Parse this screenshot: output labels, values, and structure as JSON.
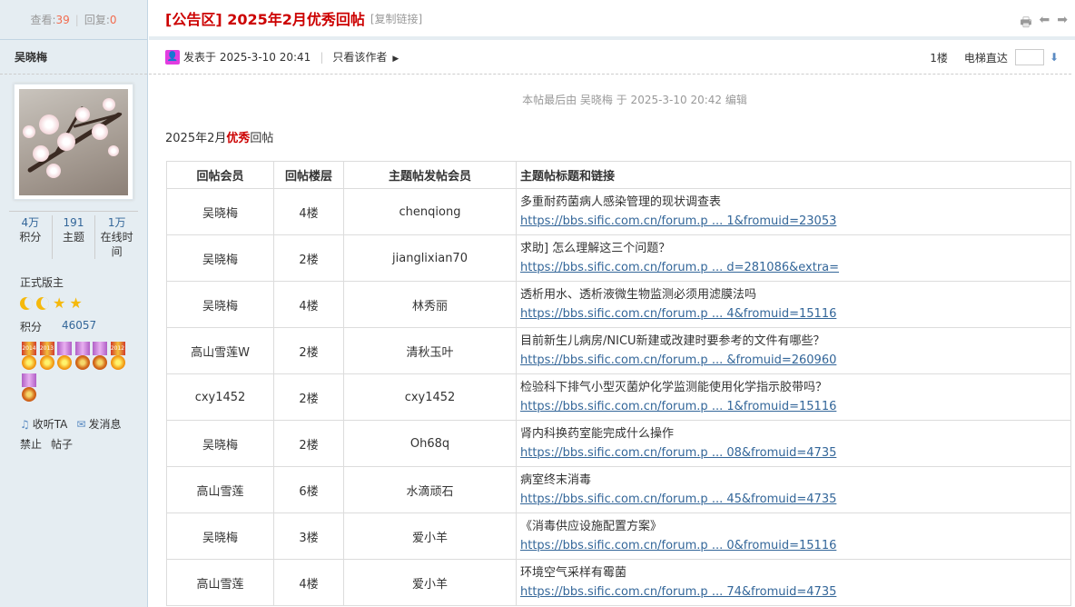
{
  "sidebar": {
    "views_label": "查看:",
    "views": "39",
    "replies_label": "回复:",
    "replies": "0",
    "author": "吴晓梅",
    "stats": [
      {
        "value": "4万",
        "label": "积分"
      },
      {
        "value": "191",
        "label": "主题"
      },
      {
        "value": "1万",
        "label": "在线时间"
      }
    ],
    "group": "正式版主",
    "score_label": "积分",
    "score_value": "46057",
    "medal_years": [
      "2014",
      "2013",
      "",
      "",
      "2012"
    ],
    "listen_label": "收听TA",
    "message_label": "发消息",
    "ban_label": "禁止",
    "posts_label": "帖子"
  },
  "header": {
    "title": "[公告区] 2025年2月优秀回帖",
    "copy_link": "[复制链接]"
  },
  "meta": {
    "posted": "发表于 2025-3-10 20:41",
    "only_author": "只看该作者",
    "floor": "1楼",
    "elevator": "电梯直达"
  },
  "edited_note": "本帖最后由 吴晓梅 于 2025-3-10 20:42 编辑",
  "content": {
    "prefix": "2025年2月",
    "highlight": "优秀",
    "suffix": "回帖"
  },
  "table": {
    "headers": [
      "回帖会员",
      "回帖楼层",
      "主题帖发帖会员",
      "主题帖标题和链接"
    ],
    "rows": [
      {
        "member": "吴晓梅",
        "floor": "4楼",
        "poster": "chenqiong",
        "title": "多重耐药菌病人感染管理的现状调查表",
        "link": "https://bbs.sific.com.cn/forum.p ... 1&fromuid=23053"
      },
      {
        "member": "吴晓梅",
        "floor": "2楼",
        "poster": "jianglixian70",
        "title": "求助] 怎么理解这三个问题？",
        "link": "https://bbs.sific.com.cn/forum.p ... d=281086&extra="
      },
      {
        "member": "吴晓梅",
        "floor": "4楼",
        "poster": "林秀丽",
        "title": "透析用水、透析液微生物监测必须用滤膜法吗",
        "link": "https://bbs.sific.com.cn/forum.p ... 4&fromuid=15116"
      },
      {
        "member": "高山雪莲W",
        "floor": "2楼",
        "poster": "清秋玉叶",
        "title": "目前新生儿病房/NICU新建或改建时要参考的文件有哪些？",
        "link": "https://bbs.sific.com.cn/forum.p ... &fromuid=260960"
      },
      {
        "member": "cxy1452",
        "floor": "2楼",
        "poster": "cxy1452",
        "title": "检验科下排气小型灭菌炉化学监测能使用化学指示胶带吗？",
        "link": "https://bbs.sific.com.cn/forum.p ... 1&fromuid=15116"
      },
      {
        "member": "吴晓梅",
        "floor": "2楼",
        "poster": "Oh68q",
        "title": "肾内科换药室能完成什么操作",
        "link": "https://bbs.sific.com.cn/forum.p ... 08&fromuid=4735"
      },
      {
        "member": "高山雪莲",
        "floor": "6楼",
        "poster": "水滴顽石",
        "title": "病室终末消毒",
        "link": "https://bbs.sific.com.cn/forum.p ... 45&fromuid=4735"
      },
      {
        "member": "吴晓梅",
        "floor": "3楼",
        "poster": "爱小羊",
        "title": "《消毒供应设施配置方案》",
        "link": "https://bbs.sific.com.cn/forum.p ... 0&fromuid=15116"
      },
      {
        "member": "高山雪莲",
        "floor": "4楼",
        "poster": "爱小羊",
        "title": "环境空气采样有霉菌",
        "link": "https://bbs.sific.com.cn/forum.p ... 74&fromuid=4735"
      }
    ]
  }
}
